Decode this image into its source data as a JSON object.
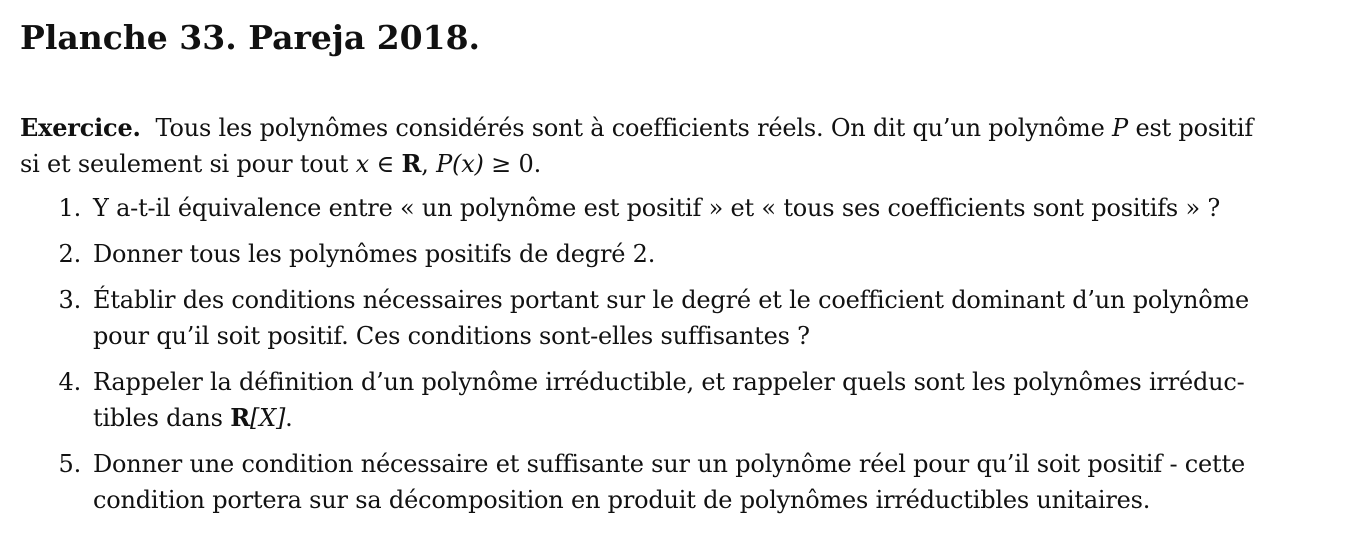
{
  "title": "Planche 33. Pareja 2018.",
  "exercise": {
    "label": "Exercice.",
    "line1_text": "Tous les polynômes considérés sont à coefficients réels. On dit qu’un polynôme",
    "line1_symbol": "P",
    "line1_end": "est positif",
    "line2_start": "si et seulement si pour tout",
    "line2_x": "x",
    "line2_in": "∈",
    "line2_R": "R",
    "line2_comma": ",",
    "line2_Px": "P(x)",
    "line2_geq": "≥ 0."
  },
  "items": [
    {
      "number": "1.",
      "text": "Y a-t-il équivalence entre « un polynôme est positif » et « tous ses coefficients sont positifs » ?"
    },
    {
      "number": "2.",
      "text": "Donner tous les polynômes positifs de degré 2."
    },
    {
      "number": "3.",
      "line1": "Établir des conditions nécessaires portant sur le degré et le coefficient dominant d’un polynôme",
      "line2": "pour qu’il soit positif. Ces conditions sont-elles suffisantes ?"
    },
    {
      "number": "4.",
      "line1": "Rappeler la définition d’un polynôme irréductible, et rappeler quels sont les polynômes irréduc-",
      "line2_start": "tibles dans",
      "line2_R": "R",
      "line2_X": "[X]",
      "line2_end": "."
    },
    {
      "number": "5.",
      "line1": "Donner une condition nécessaire et suffisante sur un polynôme réel pour qu’il soit positif - cette",
      "line2": "condition portera sur sa décomposition en produit de polynômes irréductibles unitaires."
    }
  ]
}
